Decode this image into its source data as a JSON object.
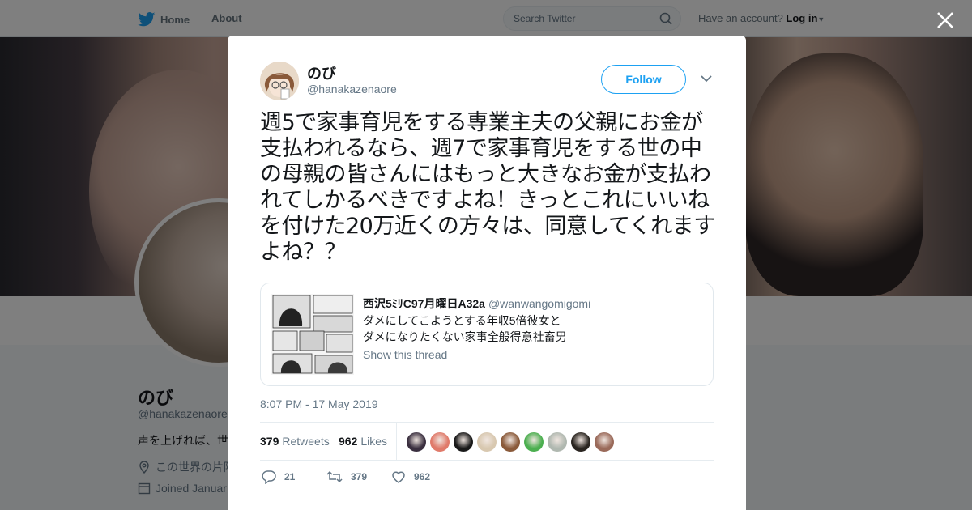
{
  "topnav": {
    "home_label": "Home",
    "about_label": "About",
    "search_placeholder": "Search Twitter",
    "account_prompt": "Have an account?",
    "login_label": "Log in"
  },
  "background_profile": {
    "name": "のび",
    "handle": "@hanakazenaore",
    "bio": "声を上げれば、世",
    "location": "この世界の片隅",
    "joined": "Joined Januar"
  },
  "tweet": {
    "author_name": "のび",
    "author_handle": "@hanakazenaore",
    "follow_label": "Follow",
    "text": "週5で家事育児をする専業主夫の父親にお金が支払われるなら、週7で家事育児をする世の中の母親の皆さんにはもっと大きなお金が支払われてしかるべきですよね！きっとこれにいいねを付けた20万近くの方々は、同意してくれますよね？？",
    "quoted": {
      "name": "西沢5ﾐﾘC97月曜日A32a",
      "handle": "@wanwangomigomi",
      "line1": "ダメにしてこようとする年収5倍彼女と",
      "line2": "ダメになりたくない家事全般得意社畜男",
      "show_thread": "Show this thread"
    },
    "timestamp": "8:07 PM - 17 May 2019",
    "retweets_count": "379",
    "retweets_label": "Retweets",
    "likes_count": "962",
    "likes_label": "Likes",
    "likers": [
      "#3a2f3f",
      "#e07a6a",
      "#1a1a1a",
      "#d8c8b0",
      "#8a5a3a",
      "#4caf50",
      "#b0b8b0",
      "#2a2520",
      "#9a6a5a"
    ],
    "reply_count": "21",
    "retweet_count_action": "379",
    "like_count_action": "962"
  },
  "colors": {
    "accent": "#1da1f2",
    "muted": "#657786"
  }
}
